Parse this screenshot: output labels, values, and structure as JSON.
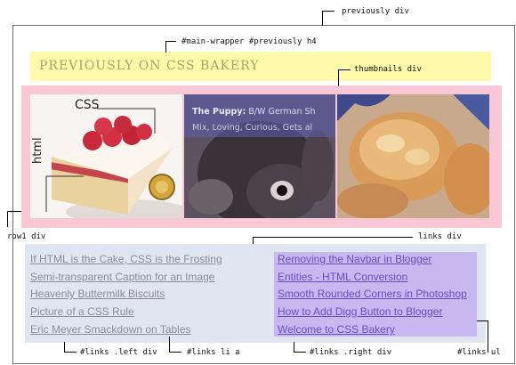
{
  "annotations": {
    "previously_div": "previously div",
    "main_wrapper_h4": "#main-wrapper #previously h4",
    "thumbnails_div": "thumbnails div",
    "row1_div": "row1 div",
    "links_div": "links div",
    "links_left_div": "#links .left div",
    "links_li_a": "#links li a",
    "links_right_div": "#links .right div",
    "links_ul": "#links ul"
  },
  "heading": "PREVIOUSLY ON CSS BAKERY",
  "thumbnails": {
    "cake_labels": [
      "CSS",
      "html"
    ],
    "caption_title": "The Puppy:",
    "caption_rest": " B/W German Sh",
    "caption_line2": "Mix, Loving, Curious, Gets al"
  },
  "links": {
    "left": [
      "If HTML is the Cake, CSS is the Frosting",
      "Semi-transparent Caption for an Image",
      "Heavenly Buttermilk Biscuits",
      "Picture of a CSS Rule",
      "Eric Meyer Smackdown on Tables"
    ],
    "right": [
      "Removing the Navbar in Blogger",
      "Entities - HTML Conversion",
      "Smooth Rounded Corners in Photoshop",
      "How to Add Digg Button to Blogger",
      "Welcome to CSS Bakery"
    ]
  },
  "colors": {
    "heading_bg": "#fdfaa9",
    "thumbnails_bg": "#f8c8d6",
    "links_bg": "#dfe6f2",
    "right_col_bg": "#c8b8f0"
  }
}
